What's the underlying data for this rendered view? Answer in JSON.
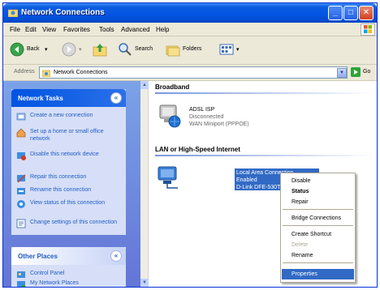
{
  "window": {
    "title": "Network Connections"
  },
  "menubar": [
    "File",
    "Edit",
    "View",
    "Favorites",
    "Tools",
    "Advanced",
    "Help"
  ],
  "toolbar": {
    "back_label": "Back",
    "search_label": "Search",
    "folders_label": "Folders"
  },
  "address": {
    "label": "Address",
    "value": "Network Connections",
    "go_label": "Go"
  },
  "network_tasks": {
    "title": "Network Tasks",
    "items": [
      "Create a new connection",
      "Set up a home or small office network",
      "Disable this network device",
      "Repair this connection",
      "Rename this connection",
      "View status of this connection",
      "Change settings of this connection"
    ]
  },
  "other_places": {
    "title": "Other Places",
    "items": [
      "Control Panel",
      "My Network Places"
    ]
  },
  "broadband": {
    "title": "Broadband",
    "name": "ADSL ISP",
    "status": "Disconnected",
    "device": "WAN Miniport (PPPOE)"
  },
  "lan": {
    "title": "LAN or High-Speed Internet",
    "name": "Local Area Connection",
    "status": "Enabled",
    "device": "D-Link DFE-530TX PCI Fast E..."
  },
  "context_menu": {
    "items": [
      "Disable",
      "Status",
      "Repair",
      "Bridge Connections",
      "Create Shortcut",
      "Delete",
      "Rename",
      "Properties"
    ]
  },
  "colors": {
    "titlebar": "#0354e3",
    "selection": "#316ac5",
    "taskpane": "#6375d6",
    "panel_bg": "#d6dff7"
  }
}
